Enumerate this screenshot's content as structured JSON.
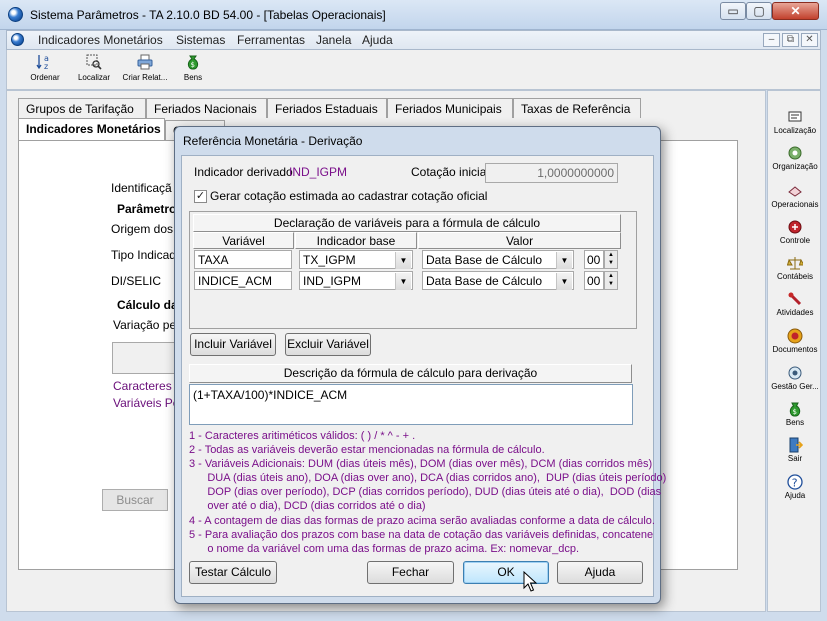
{
  "window": {
    "title": "Sistema Parâmetros -  TA 2.10.0 BD 54.00 - [Tabelas Operacionais]",
    "minimize": "▭",
    "restore": "▢",
    "close": "✕"
  },
  "menu": {
    "items": [
      "Indicadores Monetários",
      "Sistemas",
      "Ferramentas",
      "Janela",
      "Ajuda"
    ],
    "mdi": [
      "–",
      "⧉",
      "✕"
    ]
  },
  "toolbar": {
    "items": [
      {
        "label": "Ordenar",
        "icon": "sort-az-icon"
      },
      {
        "label": "Localizar",
        "icon": "find-icon"
      },
      {
        "label": "Criar Relat...",
        "icon": "printer-icon"
      },
      {
        "label": "Bens",
        "icon": "money-bag-icon"
      }
    ]
  },
  "sidebar": {
    "items": [
      {
        "label": "Localização",
        "icon": "location-icon"
      },
      {
        "label": "Organização",
        "icon": "organization-icon"
      },
      {
        "label": "Operacionais",
        "icon": "operations-icon"
      },
      {
        "label": "Controle",
        "icon": "control-icon"
      },
      {
        "label": "Contábeis",
        "icon": "scale-icon"
      },
      {
        "label": "Atividades",
        "icon": "activities-icon"
      },
      {
        "label": "Documentos",
        "icon": "documents-icon"
      },
      {
        "label": "Gestão Ger...",
        "icon": "management-icon"
      },
      {
        "label": "Bens",
        "icon": "money-bag-icon"
      },
      {
        "label": "Sair",
        "icon": "exit-icon"
      },
      {
        "label": "Ajuda",
        "icon": "help-icon"
      }
    ]
  },
  "tabs": {
    "row1": [
      "Grupos de Tarifação",
      "Feriados Nacionais",
      "Feriados Estaduais",
      "Feriados Municipais",
      "Taxas de Referência"
    ],
    "active": "Indicadores Monetários",
    "partial": "C"
  },
  "background_form": {
    "identificacao": "Identificaçã",
    "parametros": "Parâmetro",
    "origem": "Origem dos d",
    "tipo": "Tipo Indicado",
    "di_selic": "DI/SELIC",
    "calculo": "Cálculo da",
    "variacao": "Variação per",
    "caracteres": "Caracteres A",
    "variaveis": "Variáveis Per",
    "buscar": "Buscar"
  },
  "dialog": {
    "title": "Referência Monetária - Derivação",
    "indicador_label": "Indicador derivado",
    "indicador_value": "IND_IGPM",
    "cotacao_label": "Cotação inicial",
    "cotacao_value": "1,0000000000",
    "gerar_checkbox_label": "Gerar cotação estimada ao cadastrar cotação oficial",
    "gerar_checked": true,
    "check_mark": "✓",
    "grid": {
      "title": "Declaração de variáveis para a fórmula de cálculo",
      "columns": [
        "Variável",
        "Indicador base",
        "Valor"
      ],
      "rows": [
        {
          "variavel": "TAXA",
          "indicador": "TX_IGPM",
          "valor": "Data Base de Cálculo",
          "num": "00"
        },
        {
          "variavel": "INDICE_ACM",
          "indicador": "IND_IGPM",
          "valor": "Data Base de Cálculo",
          "num": "00"
        }
      ],
      "arrow": "▼",
      "spin_up": "▲",
      "spin_down": "▼"
    },
    "incluir_button": "Incluir Variável",
    "excluir_button": "Excluir Variável",
    "formula_header": "Descrição da fórmula de cálculo para derivação",
    "formula_value": "(1+TAXA/100)*INDICE_ACM",
    "help_lines": [
      "1 - Caracteres aritiméticos válidos: ( ) / * ^ - + .",
      "2 - Todas as variáveis deverão estar mencionadas na fórmula de cálculo.",
      "3 - Variáveis Adicionais: DUM (dias úteis mês), DOM (dias over mês), DCM (dias corridos mês)",
      "      DUA (dias úteis ano), DOA (dias over ano), DCA (dias corridos ano),  DUP (dias úteis período)",
      "      DOP (dias over período), DCP (dias corridos período), DUD (dias úteis até o dia),  DOD (dias",
      "      over até o dia), DCD (dias corridos até o dia)",
      "4 - A contagem de dias das formas de prazo acima serão avaliadas conforme a data de cálculo.",
      "5 - Para avaliação dos prazos com base na data de cotação das variáveis definidas, concatene",
      "      o nome da variável com uma das formas de prazo acima. Ex: nomevar_dcp."
    ],
    "buttons": {
      "testar": "Testar Cálculo",
      "fechar": "Fechar",
      "ok": "OK",
      "ajuda": "Ajuda"
    }
  }
}
